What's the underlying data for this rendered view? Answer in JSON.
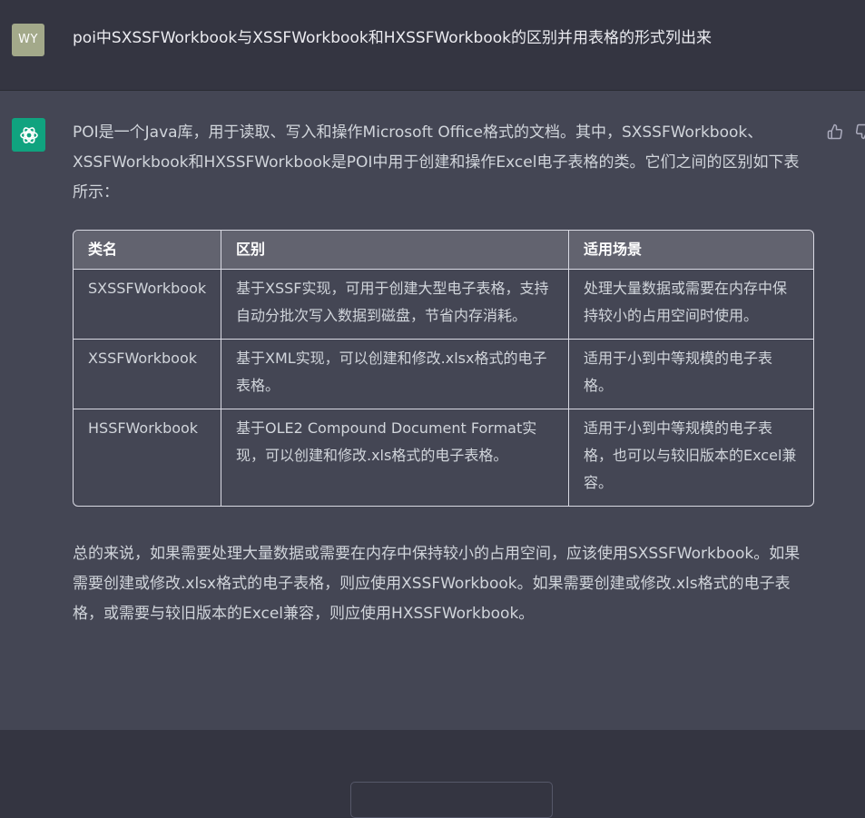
{
  "user": {
    "avatar_initials": "WY",
    "message": "poi中SXSSFWorkbook与XSSFWorkbook和HXSSFWorkbook的区别并用表格的形式列出来"
  },
  "assistant": {
    "intro": "POI是一个Java库，用于读取、写入和操作Microsoft Office格式的文档。其中，SXSSFWorkbook、XSSFWorkbook和HXSSFWorkbook是POI中用于创建和操作Excel电子表格的类。它们之间的区别如下表所示：",
    "table": {
      "headers": [
        "类名",
        "区别",
        "适用场景"
      ],
      "rows": [
        [
          "SXSSFWorkbook",
          "基于XSSF实现，可用于创建大型电子表格，支持自动分批次写入数据到磁盘，节省内存消耗。",
          "处理大量数据或需要在内存中保持较小的占用空间时使用。"
        ],
        [
          "XSSFWorkbook",
          "基于XML实现，可以创建和修改.xlsx格式的电子表格。",
          "适用于小到中等规模的电子表格。"
        ],
        [
          "HSSFWorkbook",
          "基于OLE2 Compound Document Format实现，可以创建和修改.xls格式的电子表格。",
          "适用于小到中等规模的电子表格，也可以与较旧版本的Excel兼容。"
        ]
      ]
    },
    "summary": "总的来说，如果需要处理大量数据或需要在内存中保持较小的占用空间，应该使用SXSSFWorkbook。如果需要创建或修改.xlsx格式的电子表格，则应使用XSSFWorkbook。如果需要创建或修改.xls格式的电子表格，或需要与较旧版本的Excel兼容，则应使用HXSSFWorkbook。"
  },
  "icons": {
    "avatar": "chatgpt-logo-icon",
    "thumbs_up": "thumbs-up-icon",
    "thumbs_down": "thumbs-down-icon"
  },
  "colors": {
    "accent": "#10a37f",
    "user_bg": "#343541",
    "assistant_bg": "#444654",
    "table_header_bg": "#62636f"
  }
}
